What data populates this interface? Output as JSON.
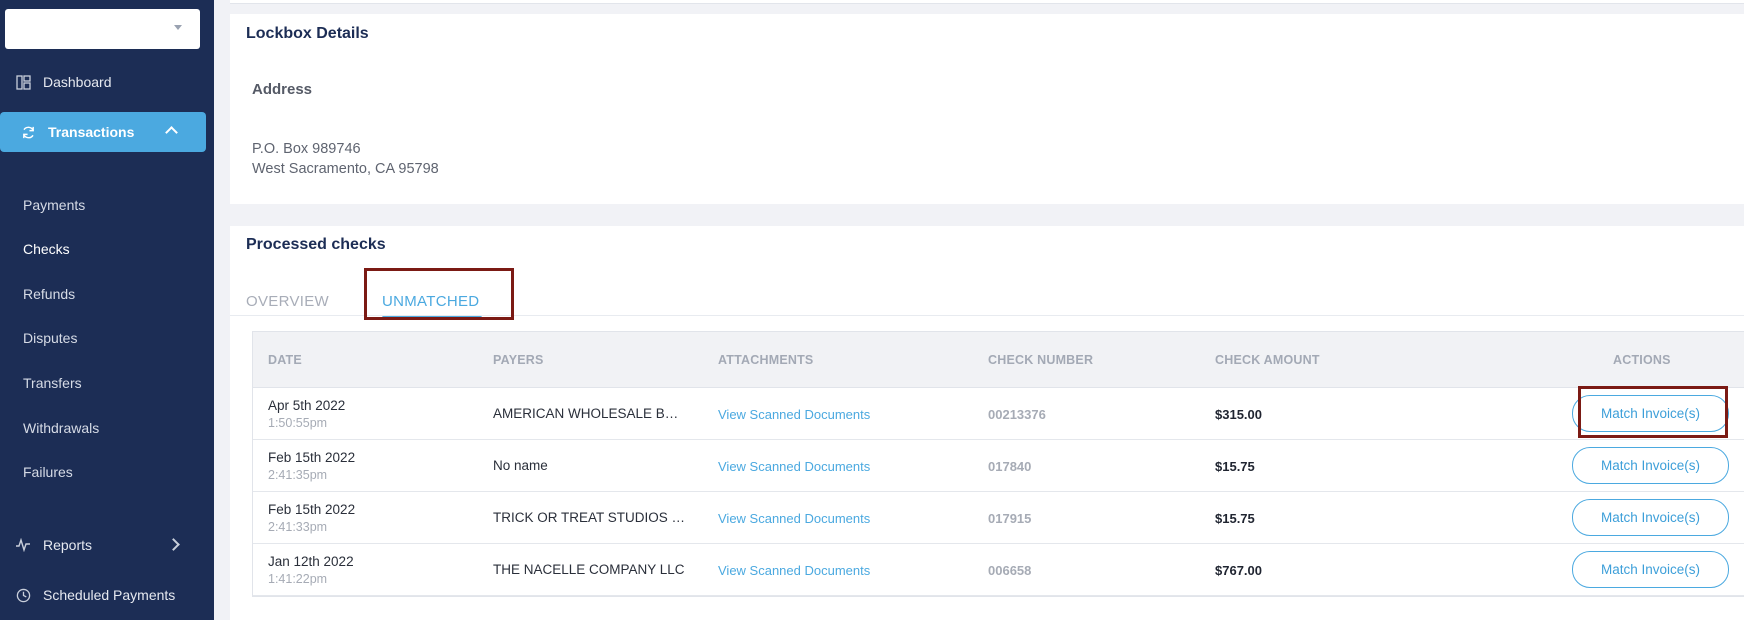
{
  "sidebar": {
    "account_select_value": "",
    "nav": {
      "dashboard": "Dashboard",
      "transactions": "Transactions",
      "reports": "Reports",
      "scheduled": "Scheduled Payments"
    },
    "sub_items": [
      "Payments",
      "Checks",
      "Refunds",
      "Disputes",
      "Transfers",
      "Withdrawals",
      "Failures"
    ]
  },
  "lockbox": {
    "title": "Lockbox Details",
    "address_label": "Address",
    "address_line1": "P.O. Box 989746",
    "address_line2": "West Sacramento, CA 95798"
  },
  "processed": {
    "title": "Processed checks",
    "tabs": [
      "OVERVIEW",
      "UNMATCHED"
    ],
    "active_tab": "UNMATCHED",
    "columns": [
      "DATE",
      "PAYERS",
      "ATTACHMENTS",
      "CHECK NUMBER",
      "CHECK AMOUNT",
      "ACTIONS"
    ],
    "rows": [
      {
        "date": "Apr 5th 2022",
        "time": "1:50:55pm",
        "payer": "AMERICAN WHOLESALE BOOK COMPANY",
        "attachments": "View Scanned Documents",
        "check_number": "00213376",
        "amount": "$315.00",
        "action": "Match Invoice(s)"
      },
      {
        "date": "Feb 15th 2022",
        "time": "2:41:35pm",
        "payer": "No name",
        "attachments": "View Scanned Documents",
        "check_number": "017840",
        "amount": "$15.75",
        "action": "Match Invoice(s)"
      },
      {
        "date": "Feb 15th 2022",
        "time": "2:41:33pm",
        "payer": "TRICK OR TREAT STUDIOS INC",
        "attachments": "View Scanned Documents",
        "check_number": "017915",
        "amount": "$15.75",
        "action": "Match Invoice(s)"
      },
      {
        "date": "Jan 12th 2022",
        "time": "1:41:22pm",
        "payer": "THE NACELLE COMPANY LLC",
        "attachments": "View Scanned Documents",
        "check_number": "006658",
        "amount": "$767.00",
        "action": "Match Invoice(s)"
      }
    ]
  },
  "colors": {
    "sidebar_bg": "#1c2d55",
    "accent": "#4ba9e0",
    "highlight_box": "#7b1a14"
  }
}
